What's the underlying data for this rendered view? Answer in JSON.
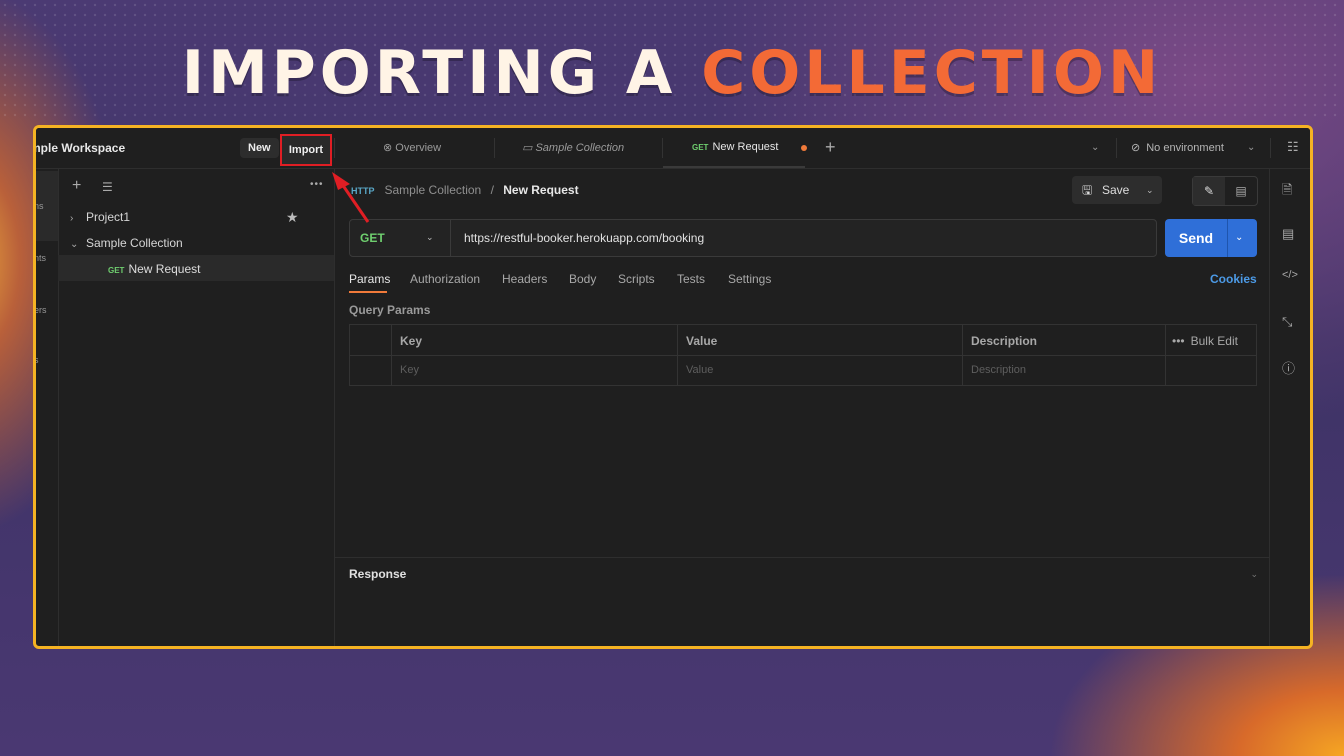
{
  "headline": {
    "part1": "IMPORTING A",
    "part2": "COLLECTION",
    "accent_color": "#f36a36"
  },
  "topbar": {
    "workspace_title": "mple Workspace",
    "new_label": "New",
    "import_label": "Import",
    "tabs": [
      {
        "label": "Overview",
        "icon": "overview-icon"
      },
      {
        "label": "Sample Collection",
        "icon": "collection-icon"
      },
      {
        "method": "GET",
        "label": "New Request"
      }
    ],
    "environment": "No environment"
  },
  "sidebar": {
    "rail_items": [
      "ns",
      "nts",
      "ers",
      "s"
    ],
    "tree": [
      {
        "label": "Project1"
      },
      {
        "label": "Sample Collection"
      },
      {
        "method": "GET",
        "label": "New Request"
      }
    ]
  },
  "request": {
    "breadcrumb_root": "Sample Collection",
    "breadcrumb_sep": "/",
    "breadcrumb_current": "New Request",
    "http_badge": "HTTP",
    "save_label": "Save",
    "method": "GET",
    "url": "https://restful-booker.herokuapp.com/booking",
    "send_label": "Send",
    "tabs": [
      "Params",
      "Authorization",
      "Headers",
      "Body",
      "Scripts",
      "Tests",
      "Settings"
    ],
    "cookies_label": "Cookies",
    "query_params_label": "Query Params",
    "table": {
      "headers": [
        "Key",
        "Value",
        "Description"
      ],
      "placeholders": [
        "Key",
        "Value",
        "Description"
      ],
      "bulk_edit": "Bulk Edit"
    },
    "response_label": "Response"
  },
  "colors": {
    "highlight_border": "#f5b323",
    "import_box": "#e01e24",
    "send_button": "#2f6fd8",
    "get_method": "#6fcf6f"
  }
}
